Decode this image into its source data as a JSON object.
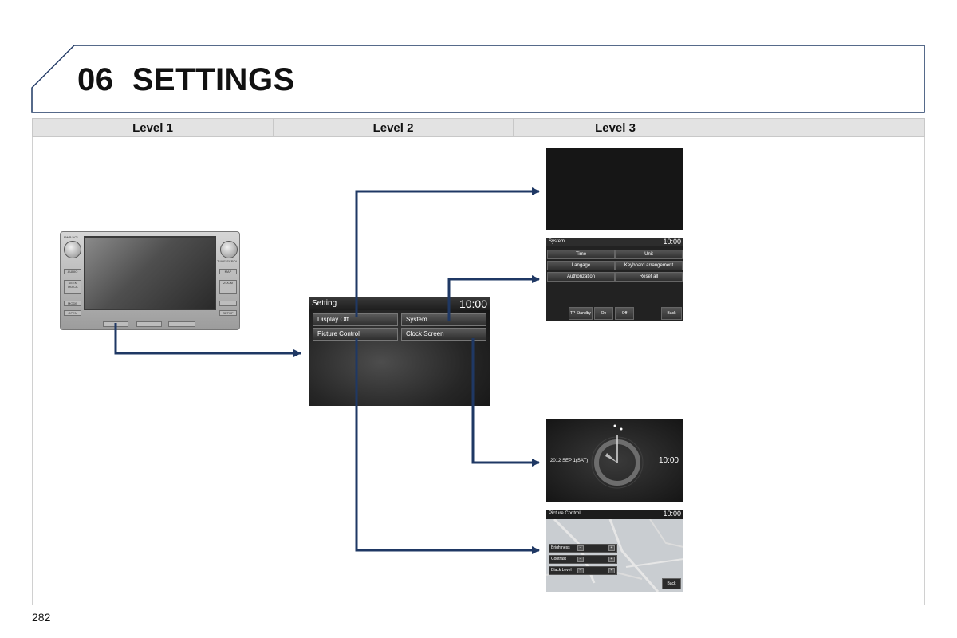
{
  "header": {
    "title": "06  SETTINGS"
  },
  "columns": [
    "Level 1",
    "Level 2",
    "Level 3"
  ],
  "page_number": "282",
  "head_unit": {
    "labels_left": [
      "PWR·VOL",
      "AUDIO",
      "SEEK TRACK",
      "MODE",
      "OPEN"
    ],
    "labels_right": [
      "TUNE·SCROLL",
      "MAP",
      "ZOOM",
      "",
      "SETUP"
    ]
  },
  "setting_screen": {
    "title": "Setting",
    "time": "10:00",
    "buttons": [
      "Display Off",
      "System",
      "Picture Control",
      "Clock Screen"
    ]
  },
  "system_screen": {
    "title": "System",
    "time": "10:00",
    "cells": [
      "Time",
      "Unit",
      "Langage",
      "Keyboard arrangement",
      "Authorization",
      "Reset all"
    ],
    "bottom": [
      "TP Standby",
      "On",
      "Off",
      "Back"
    ]
  },
  "clock_screen": {
    "date": "2012  SEP 1(SAT)",
    "time": "10:00"
  },
  "picture_screen": {
    "title": "Picture Control",
    "time": "10:00",
    "rows": [
      "Brightness",
      "Contrast",
      "Black Level"
    ],
    "back": "Back"
  },
  "colors": {
    "arrow": "#1f3864",
    "frame": "#1f3864"
  }
}
